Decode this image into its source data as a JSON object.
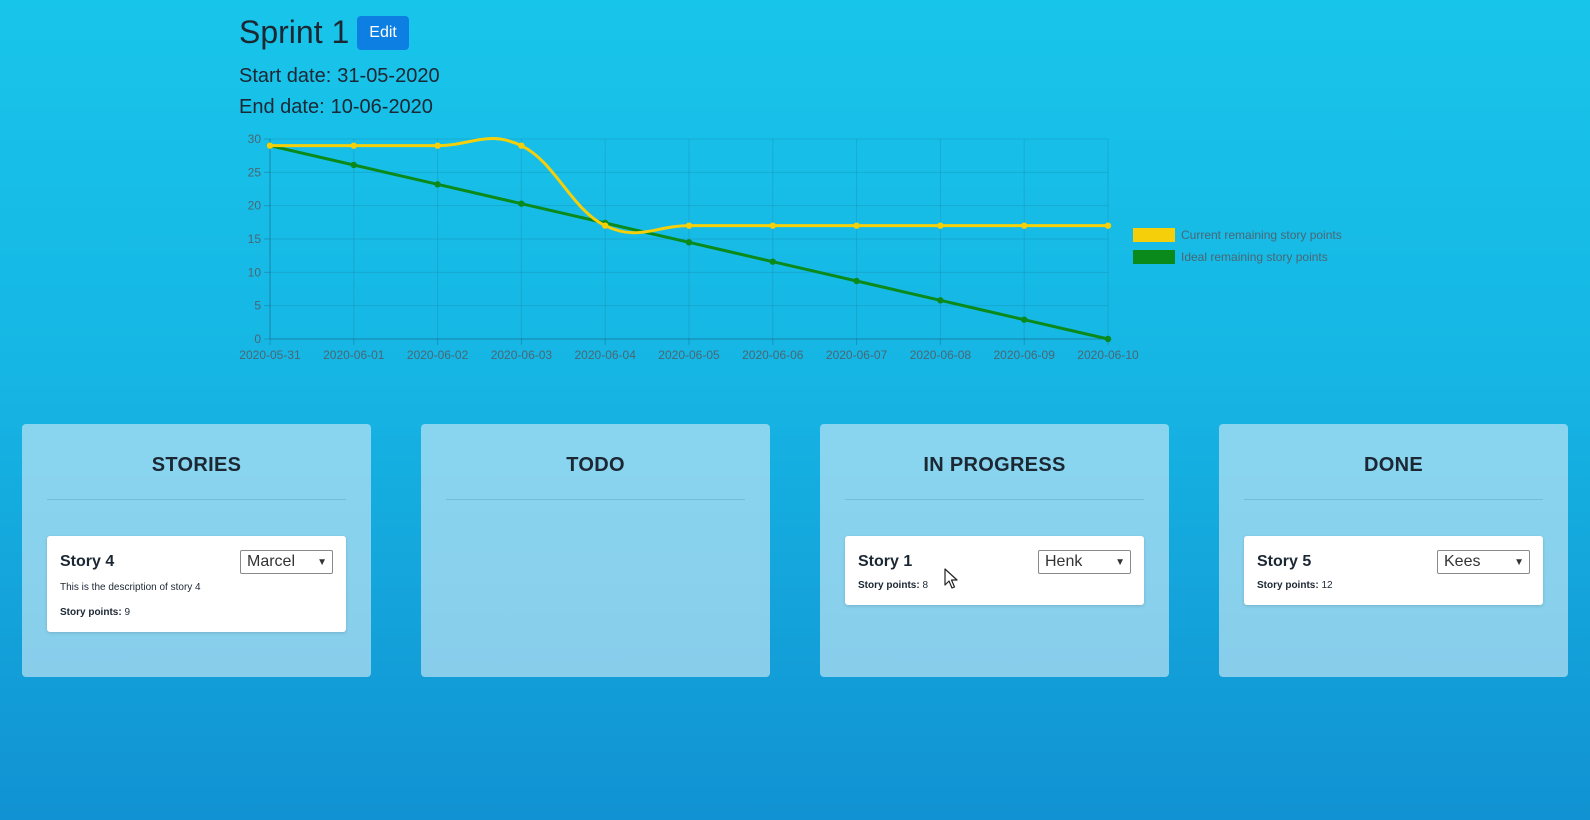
{
  "sprint": {
    "title": "Sprint 1",
    "edit_label": "Edit",
    "start_label": "Start date:",
    "start_date": "31-05-2020",
    "end_label": "End date:",
    "end_date": "10-06-2020"
  },
  "chart_data": {
    "type": "line",
    "x": [
      "2020-05-31",
      "2020-06-01",
      "2020-06-02",
      "2020-06-03",
      "2020-06-04",
      "2020-06-05",
      "2020-06-06",
      "2020-06-07",
      "2020-06-08",
      "2020-06-09",
      "2020-06-10"
    ],
    "series": [
      {
        "name": "Current remaining story points",
        "color": "#f5d00a",
        "values": [
          29,
          29,
          29,
          29,
          17,
          17,
          17,
          17,
          17,
          17,
          17
        ]
      },
      {
        "name": "Ideal remaining story points",
        "color": "#0b8a1c",
        "values": [
          29,
          26.1,
          23.2,
          20.3,
          17.4,
          14.5,
          11.6,
          8.7,
          5.8,
          2.9,
          0
        ]
      }
    ],
    "ylim": [
      0,
      30
    ],
    "yticks": [
      0,
      5,
      10,
      15,
      20,
      25,
      30
    ],
    "grid": true,
    "legend_position": "right"
  },
  "board": {
    "columns": [
      {
        "title": "STORIES",
        "cards": [
          {
            "title": "Story 4",
            "assignee": "Marcel",
            "description": "This is the description of story 4",
            "points_label": "Story points:",
            "points": "9"
          }
        ]
      },
      {
        "title": "TODO",
        "cards": []
      },
      {
        "title": "IN PROGRESS",
        "cards": [
          {
            "title": "Story 1",
            "assignee": "Henk",
            "points_label": "Story points:",
            "points": "8"
          }
        ]
      },
      {
        "title": "DONE",
        "cards": [
          {
            "title": "Story 5",
            "assignee": "Kees",
            "points_label": "Story points:",
            "points": "12"
          }
        ]
      }
    ]
  }
}
